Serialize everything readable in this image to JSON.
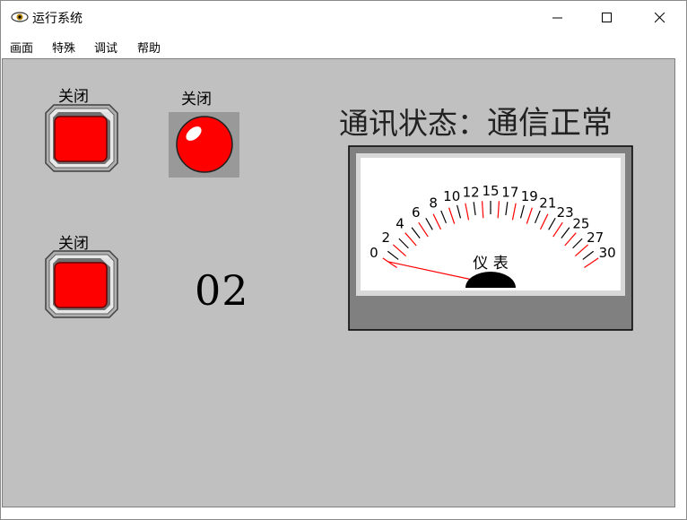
{
  "window": {
    "title": "运行系统",
    "minimize_glyph": "—",
    "maximize_glyph": "☐",
    "close_glyph": "✕"
  },
  "menu": [
    "画面",
    "特殊",
    "调试",
    "帮助"
  ],
  "controls": {
    "button1_label": "关闭",
    "lamp_label": "关闭",
    "button2_label": "关闭",
    "display_value": "02"
  },
  "comm_status": {
    "label": "通讯状态：",
    "value": "通信正常"
  },
  "gauge": {
    "label": "仪 表",
    "min": 0,
    "max": 30,
    "value": 0,
    "tick_labels": [
      "0",
      "2",
      "4",
      "6",
      "8",
      "10",
      "12",
      "15",
      "17",
      "19",
      "21",
      "23",
      "25",
      "27",
      "30"
    ],
    "colors": {
      "major_tick": "#ff0000",
      "needle": "#ff0000",
      "face": "#ffffff",
      "frame": "#808080"
    }
  },
  "colors": {
    "button_red": "#ff0000",
    "canvas": "#c0c0c0"
  },
  "icons": {
    "app": "eye-icon"
  }
}
